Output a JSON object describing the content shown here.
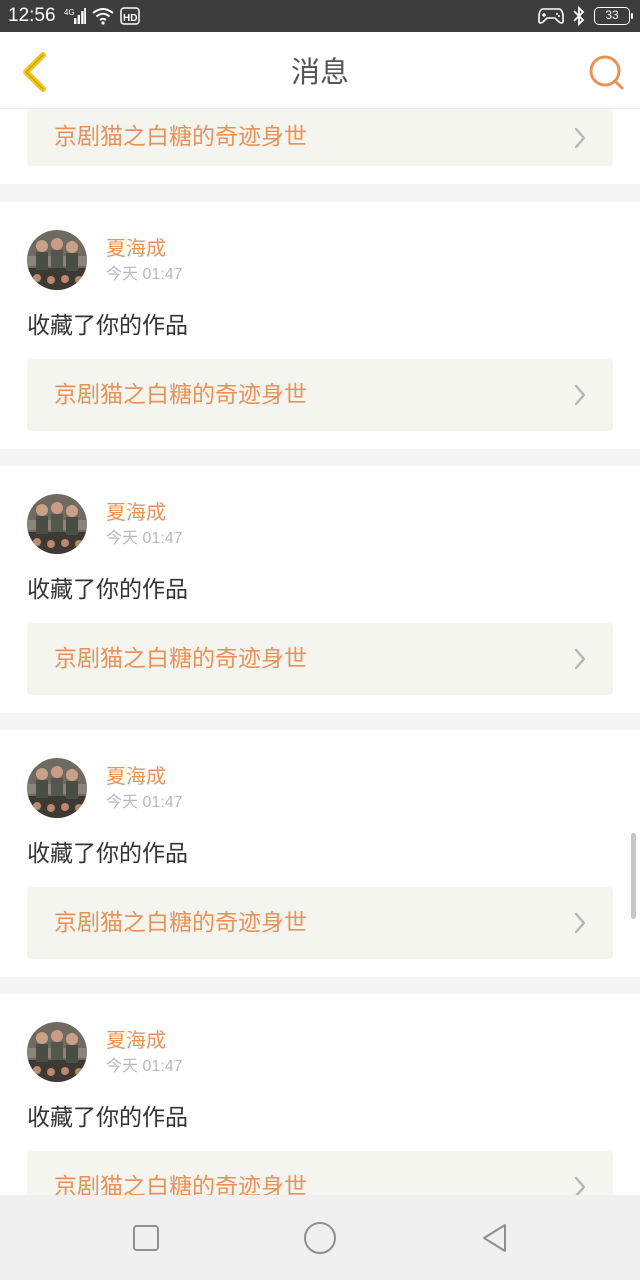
{
  "status_bar": {
    "time": "12:56",
    "network_label": "4G",
    "hd_label": "HD",
    "battery_level": "33"
  },
  "header": {
    "title": "消息",
    "back_icon": "chevron-left-icon",
    "search_icon": "search-icon"
  },
  "first_card": {
    "work_title": "京剧猫之白糖的奇迹身世"
  },
  "messages": [
    {
      "user_name": "夏海成",
      "time": "今天 01:47",
      "action": "收藏了你的作品",
      "work_title": "京剧猫之白糖的奇迹身世"
    },
    {
      "user_name": "夏海成",
      "time": "今天 01:47",
      "action": "收藏了你的作品",
      "work_title": "京剧猫之白糖的奇迹身世"
    },
    {
      "user_name": "夏海成",
      "time": "今天 01:47",
      "action": "收藏了你的作品",
      "work_title": "京剧猫之白糖的奇迹身世"
    },
    {
      "user_name": "夏海成",
      "time": "今天 01:47",
      "action": "收藏了你的作品",
      "work_title": "京剧猫之白糖的奇迹身世"
    }
  ],
  "colors": {
    "accent": "#e89259",
    "back_icon": "#f2c418",
    "link_background": "#f5f5f0"
  },
  "nav_bar": {
    "recent_icon": "square-icon",
    "home_icon": "circle-icon",
    "back_icon": "triangle-back-icon"
  }
}
